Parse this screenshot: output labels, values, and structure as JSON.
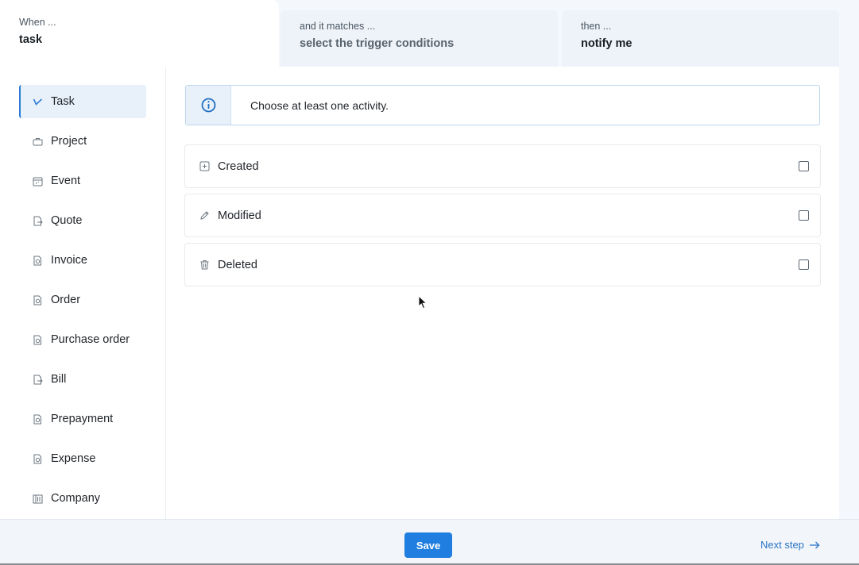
{
  "steps": [
    {
      "label": "When ...",
      "value": "task"
    },
    {
      "label": "and it matches ...",
      "value": "select the trigger conditions"
    },
    {
      "label": "then ...",
      "value": "notify me"
    }
  ],
  "sidebar": {
    "items": [
      {
        "label": "Task",
        "icon": "check-icon",
        "active": true
      },
      {
        "label": "Project",
        "icon": "briefcase-icon"
      },
      {
        "label": "Event",
        "icon": "calendar-icon"
      },
      {
        "label": "Quote",
        "icon": "document-arrow-icon"
      },
      {
        "label": "Invoice",
        "icon": "document-money-icon"
      },
      {
        "label": "Order",
        "icon": "document-money-icon"
      },
      {
        "label": "Purchase order",
        "icon": "document-money-icon"
      },
      {
        "label": "Bill",
        "icon": "document-arrow-icon"
      },
      {
        "label": "Prepayment",
        "icon": "document-money-icon"
      },
      {
        "label": "Expense",
        "icon": "document-money-icon"
      },
      {
        "label": "Company",
        "icon": "building-icon"
      }
    ]
  },
  "info": {
    "text": "Choose at least one activity.",
    "icon": "info-icon"
  },
  "activities": [
    {
      "label": "Created",
      "icon": "plus-square-icon",
      "checked": false
    },
    {
      "label": "Modified",
      "icon": "pencil-icon",
      "checked": false
    },
    {
      "label": "Deleted",
      "icon": "trash-icon",
      "checked": false
    }
  ],
  "footer": {
    "save_label": "Save",
    "next_label": "Next step"
  },
  "colors": {
    "accent": "#1f7ee0",
    "active_bg": "#e8f1fa",
    "link": "#2a74c4"
  }
}
